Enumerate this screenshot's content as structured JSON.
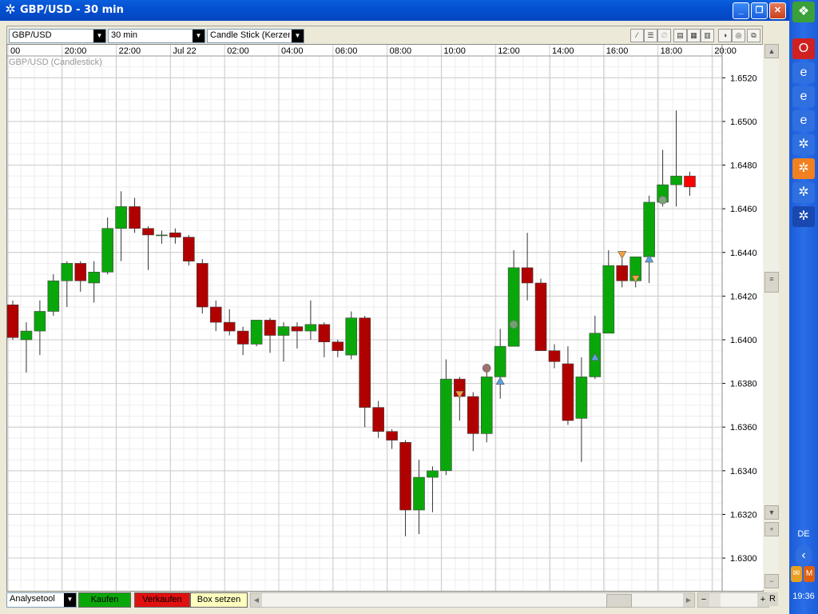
{
  "window": {
    "title": "GBP/USD - 30 min"
  },
  "toolbar": {
    "symbol": "GBP/USD",
    "interval": "30 min",
    "chart_type": "Candle Stick (Kerzen"
  },
  "chart_title": "GBP/USD (Candlestick)",
  "bottom": {
    "analysis": "Analysetool",
    "buy": "Kaufen",
    "sell": "Verkaufen",
    "box": "Box setzen",
    "r": "R"
  },
  "taskbar": {
    "lang": "DE",
    "clock": "19:36"
  },
  "colors": {
    "up": "#0aa70a",
    "down": "#b00000",
    "last": "#ff0000"
  },
  "chart_data": {
    "type": "candlestick",
    "title": "GBP/USD (Candlestick)",
    "time_labels": [
      "00",
      "20:00",
      "22:00",
      "Jul 22",
      "02:00",
      "04:00",
      "06:00",
      "08:00",
      "10:00",
      "12:00",
      "14:00",
      "16:00",
      "18:00",
      "20:00"
    ],
    "y_ticks": [
      "1.6520",
      "1.6500",
      "1.6480",
      "1.6460",
      "1.6440",
      "1.6420",
      "1.6400",
      "1.6380",
      "1.6360",
      "1.6340",
      "1.6320",
      "1.6300"
    ],
    "ylim": [
      1.6285,
      1.653
    ],
    "candles": [
      {
        "o": 1.6416,
        "h": 1.6418,
        "l": 1.64,
        "c": 1.6401
      },
      {
        "o": 1.64,
        "h": 1.6408,
        "l": 1.6385,
        "c": 1.6404
      },
      {
        "o": 1.6404,
        "h": 1.6418,
        "l": 1.6393,
        "c": 1.6413
      },
      {
        "o": 1.6413,
        "h": 1.643,
        "l": 1.6411,
        "c": 1.6427
      },
      {
        "o": 1.6427,
        "h": 1.6436,
        "l": 1.6415,
        "c": 1.6435
      },
      {
        "o": 1.6435,
        "h": 1.6436,
        "l": 1.6422,
        "c": 1.6427
      },
      {
        "o": 1.6426,
        "h": 1.6436,
        "l": 1.6417,
        "c": 1.6431
      },
      {
        "o": 1.6431,
        "h": 1.6456,
        "l": 1.643,
        "c": 1.6451
      },
      {
        "o": 1.6451,
        "h": 1.6468,
        "l": 1.6436,
        "c": 1.6461
      },
      {
        "o": 1.6461,
        "h": 1.6465,
        "l": 1.6449,
        "c": 1.6451
      },
      {
        "o": 1.6451,
        "h": 1.6452,
        "l": 1.6432,
        "c": 1.6448
      },
      {
        "o": 1.6448,
        "h": 1.645,
        "l": 1.6444,
        "c": 1.6448
      },
      {
        "o": 1.6449,
        "h": 1.6451,
        "l": 1.6444,
        "c": 1.6447
      },
      {
        "o": 1.6447,
        "h": 1.6448,
        "l": 1.6434,
        "c": 1.6436
      },
      {
        "o": 1.6435,
        "h": 1.6437,
        "l": 1.6412,
        "c": 1.6415
      },
      {
        "o": 1.6415,
        "h": 1.6418,
        "l": 1.6404,
        "c": 1.6408
      },
      {
        "o": 1.6408,
        "h": 1.6414,
        "l": 1.6402,
        "c": 1.6404
      },
      {
        "o": 1.6404,
        "h": 1.6406,
        "l": 1.6393,
        "c": 1.6398
      },
      {
        "o": 1.6398,
        "h": 1.6409,
        "l": 1.6397,
        "c": 1.6409
      },
      {
        "o": 1.6409,
        "h": 1.641,
        "l": 1.6394,
        "c": 1.6402
      },
      {
        "o": 1.6402,
        "h": 1.6408,
        "l": 1.639,
        "c": 1.6406
      },
      {
        "o": 1.6406,
        "h": 1.6408,
        "l": 1.6396,
        "c": 1.6404
      },
      {
        "o": 1.6404,
        "h": 1.6418,
        "l": 1.64,
        "c": 1.6407
      },
      {
        "o": 1.6407,
        "h": 1.6408,
        "l": 1.6392,
        "c": 1.6399
      },
      {
        "o": 1.6399,
        "h": 1.64,
        "l": 1.6392,
        "c": 1.6395
      },
      {
        "o": 1.6393,
        "h": 1.6413,
        "l": 1.6391,
        "c": 1.641
      },
      {
        "o": 1.641,
        "h": 1.6411,
        "l": 1.636,
        "c": 1.6369
      },
      {
        "o": 1.6369,
        "h": 1.6372,
        "l": 1.6355,
        "c": 1.6358
      },
      {
        "o": 1.6358,
        "h": 1.6359,
        "l": 1.635,
        "c": 1.6354
      },
      {
        "o": 1.6353,
        "h": 1.6354,
        "l": 1.631,
        "c": 1.6322
      },
      {
        "o": 1.6322,
        "h": 1.6345,
        "l": 1.6311,
        "c": 1.6337
      },
      {
        "o": 1.6337,
        "h": 1.6342,
        "l": 1.6321,
        "c": 1.634
      },
      {
        "o": 1.634,
        "h": 1.6391,
        "l": 1.6338,
        "c": 1.6382
      },
      {
        "o": 1.6382,
        "h": 1.6383,
        "l": 1.6363,
        "c": 1.6374
      },
      {
        "o": 1.6374,
        "h": 1.6376,
        "l": 1.6349,
        "c": 1.6357
      },
      {
        "o": 1.6357,
        "h": 1.6389,
        "l": 1.6353,
        "c": 1.6383
      },
      {
        "o": 1.6383,
        "h": 1.6405,
        "l": 1.6373,
        "c": 1.6397
      },
      {
        "o": 1.6397,
        "h": 1.6441,
        "l": 1.6397,
        "c": 1.6433
      },
      {
        "o": 1.6433,
        "h": 1.6449,
        "l": 1.6418,
        "c": 1.6426
      },
      {
        "o": 1.6426,
        "h": 1.6428,
        "l": 1.6396,
        "c": 1.6395
      },
      {
        "o": 1.6395,
        "h": 1.6398,
        "l": 1.6387,
        "c": 1.639
      },
      {
        "o": 1.6389,
        "h": 1.6397,
        "l": 1.6361,
        "c": 1.6363
      },
      {
        "o": 1.6364,
        "h": 1.6392,
        "l": 1.6344,
        "c": 1.6383
      },
      {
        "o": 1.6383,
        "h": 1.6411,
        "l": 1.6382,
        "c": 1.6403
      },
      {
        "o": 1.6403,
        "h": 1.6441,
        "l": 1.6403,
        "c": 1.6434
      },
      {
        "o": 1.6434,
        "h": 1.6437,
        "l": 1.6424,
        "c": 1.6427
      },
      {
        "o": 1.6427,
        "h": 1.6437,
        "l": 1.6424,
        "c": 1.6438
      },
      {
        "o": 1.6438,
        "h": 1.6466,
        "l": 1.6426,
        "c": 1.6463
      },
      {
        "o": 1.6463,
        "h": 1.6487,
        "l": 1.6461,
        "c": 1.6471
      },
      {
        "o": 1.6471,
        "h": 1.6505,
        "l": 1.6461,
        "c": 1.6475
      },
      {
        "o": 1.6475,
        "h": 1.6477,
        "l": 1.6466,
        "c": 1.647
      }
    ],
    "markers": [
      {
        "i": 33,
        "p": 1.6375,
        "kind": "tri-down",
        "color": "#f0a040"
      },
      {
        "i": 35,
        "p": 1.6387,
        "kind": "circle",
        "color": "#a07070"
      },
      {
        "i": 36,
        "p": 1.6381,
        "kind": "tri-up",
        "color": "#60a0e0"
      },
      {
        "i": 37,
        "p": 1.6407,
        "kind": "circle",
        "color": "#70a070"
      },
      {
        "i": 43,
        "p": 1.6392,
        "kind": "tri-up",
        "color": "#60a0e0"
      },
      {
        "i": 45,
        "p": 1.6439,
        "kind": "tri-down",
        "color": "#f0a040"
      },
      {
        "i": 46,
        "p": 1.6428,
        "kind": "tri-down",
        "color": "#f0a040"
      },
      {
        "i": 47,
        "p": 1.6437,
        "kind": "tri-up",
        "color": "#60a0e0"
      },
      {
        "i": 48,
        "p": 1.6464,
        "kind": "circle",
        "color": "#80a080"
      }
    ]
  }
}
